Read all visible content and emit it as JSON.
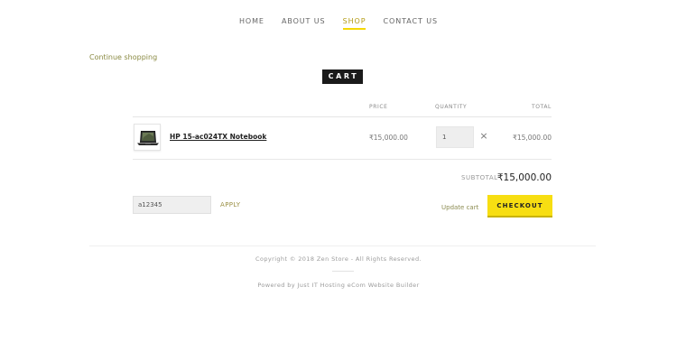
{
  "nav": {
    "items": [
      {
        "label": "HOME",
        "active": false
      },
      {
        "label": "ABOUT US",
        "active": false
      },
      {
        "label": "SHOP",
        "active": true
      },
      {
        "label": "CONTACT US",
        "active": false
      }
    ],
    "accent_color": "#f5d800"
  },
  "continue_shopping": "Continue shopping",
  "cart_badge": "CART",
  "table": {
    "headers": {
      "price": "PRICE",
      "quantity": "QUANTITY",
      "total": "TOTAL"
    },
    "rows": [
      {
        "product": "HP 15-ac024TX Notebook",
        "price": "₹15,000.00",
        "quantity": "1",
        "total": "₹15,000.00",
        "remove_icon": "close-icon"
      }
    ]
  },
  "subtotal": {
    "label": "SUBTOTAL",
    "value": "₹15,000.00"
  },
  "coupon": {
    "value": "a12345",
    "apply_label": "APPLY"
  },
  "actions": {
    "update_cart": "Update cart",
    "checkout": "CHECKOUT",
    "checkout_color": "#f7de12"
  },
  "footer": {
    "copyright": "Copyright © 2018 Zen Store - All Rights Reserved.",
    "powered": "Powered by Just IT Hosting eCom Website Builder"
  }
}
